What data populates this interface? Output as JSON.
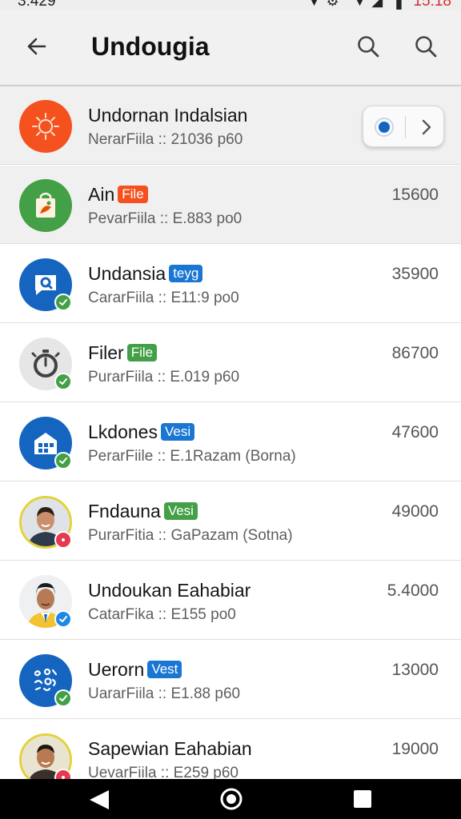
{
  "status": {
    "time": "3:429",
    "icons": "▼⚙ ▼◢ ▌",
    "battery": "15:18",
    "battery_color": "#d32f2f"
  },
  "appbar": {
    "title": "Undougia",
    "back_icon": "arrow-left-icon",
    "search_icon": "search-icon"
  },
  "colors": {
    "check_green": "#43a047",
    "check_blue": "#1e88e5",
    "red_badge": "#e53950",
    "primary_blue": "#1565c0"
  },
  "items": [
    {
      "name": "Undornan Indalsian",
      "tag": "",
      "sub": "NerarFiila :: 21036 p60",
      "amount": "",
      "shaded": true,
      "avatar": "sun-logo-icon",
      "avatar_color": "#f4511e",
      "badge": "",
      "has_toggle": true
    },
    {
      "name": "Ain",
      "tag": "File",
      "tag_color": "#f4511e",
      "sub": "PevarFiila :: E.883 po0",
      "amount": "15600",
      "shaded": true,
      "avatar": "shopping-bag-icon",
      "avatar_color": "#43a047",
      "badge": ""
    },
    {
      "name": "Undansia",
      "tag": "teyg",
      "tag_color": "#1976d2",
      "sub": "CararFiila :: E11:9 po0",
      "amount": "35900",
      "avatar": "chat-bubble-icon",
      "avatar_color": "#1565c0",
      "badge": "check-green"
    },
    {
      "name": "Filer",
      "tag": "File",
      "tag_color": "#43a047",
      "sub": "PurarFiila :: E.019 p60",
      "amount": "86700",
      "avatar": "stopwatch-icon",
      "avatar_color": "#e6e6e6",
      "badge": "check-green"
    },
    {
      "name": "Lkdones",
      "tag": "Vesi",
      "tag_color": "#1976d2",
      "sub": "PerarFiile :: E.1Razam (Borna)",
      "amount": "47600",
      "avatar": "building-icon",
      "avatar_color": "#1565c0",
      "badge": "check-green"
    },
    {
      "name": "Fndauna",
      "tag": "Vesi",
      "tag_color": "#43a047",
      "sub": "PurarFitia :: GaPazam (Sotna)",
      "amount": "49000",
      "avatar": "person-photo-icon",
      "avatar_color": "#f1f1f1",
      "badge": "red"
    },
    {
      "name": "Undoukan Eahabiar",
      "tag": "",
      "sub": "CatarFika :: E155 po0",
      "amount": "5.4000",
      "avatar": "person-photo-icon",
      "avatar_color": "#f1f1f1",
      "badge": "check-blue"
    },
    {
      "name": "Uerorn",
      "tag": "Vest",
      "tag_color": "#1976d2",
      "sub": "UararFiila :: E1.88 p60",
      "amount": "13000",
      "avatar": "symbols-logo-icon",
      "avatar_color": "#1565c0",
      "badge": "check-green"
    },
    {
      "name": "Sapewian Eahabian",
      "tag": "",
      "sub": "UevarFiila :: E259 p60",
      "amount": "19000",
      "avatar": "person-photo-icon",
      "avatar_color": "#f1f1f1",
      "badge": "red"
    }
  ],
  "navbar": {
    "back_icon": "nav-back-icon",
    "home_icon": "nav-home-icon",
    "recents_icon": "nav-recents-icon"
  }
}
